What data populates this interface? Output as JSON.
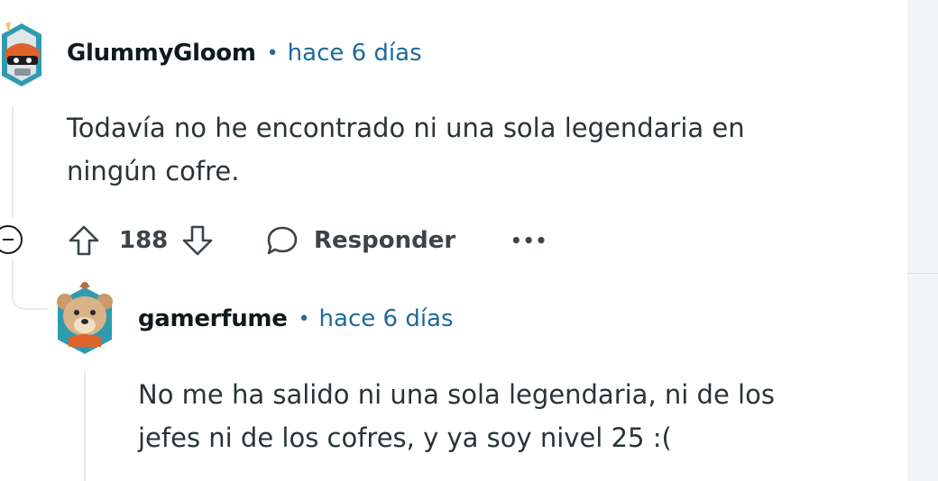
{
  "comments": [
    {
      "username": "GlummyGloom",
      "separator": "•",
      "time": "hace 6 días",
      "lines": [
        "Todavía no he encontrado ni una sola legendaria en",
        "ningún cofre."
      ],
      "score": "188",
      "reply_label": "Responder",
      "more_label": "•••",
      "avatar_icon": "robot-helmet-avatar-icon"
    },
    {
      "username": "gamerfume",
      "separator": "•",
      "time": "hace 6 días",
      "lines": [
        "No me ha salido ni una sola legendaria, ni de los",
        "jefes ni de los cofres, y ya soy nivel 25 :("
      ],
      "avatar_icon": "bear-avatar-icon"
    }
  ],
  "colors": {
    "link_blue": "#1d6a9b",
    "text_main": "#2a3336",
    "thread_line": "#e5ebee",
    "avatar_teal": "#2f9bb0"
  }
}
